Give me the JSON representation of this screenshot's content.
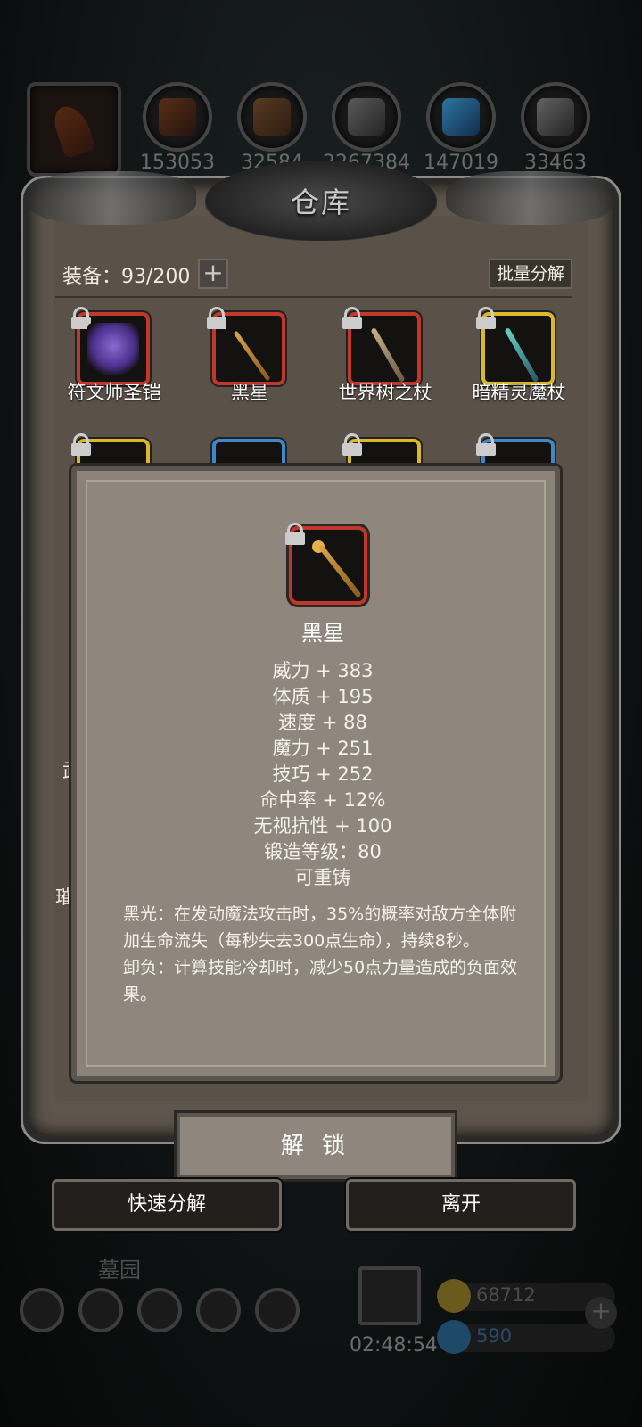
{
  "resources": {
    "counts": [
      "153053",
      "32584",
      "2267384",
      "147019",
      "33463"
    ]
  },
  "warehouse": {
    "title": "仓库",
    "equip_label": "装备：93/200",
    "plus_label": "+",
    "batch_label": "批量分解",
    "items_row1": [
      {
        "name": "符文师圣铠",
        "rarity": "red",
        "icon": "armor-icon"
      },
      {
        "name": "黑星",
        "rarity": "red",
        "icon": "staff-icon"
      },
      {
        "name": "世界树之杖",
        "rarity": "red",
        "icon": "staff-icon"
      },
      {
        "name": "暗精灵魔杖",
        "rarity": "gold",
        "icon": "staff-icon"
      }
    ],
    "side_text": {
      "left_1": "武",
      "left_2": "璀"
    }
  },
  "detail": {
    "name": "黑星",
    "stats": [
      "威力 + 383",
      "体质 + 195",
      "速度 + 88",
      "魔力 + 251",
      "技巧 + 252",
      "命中率 + 12%",
      "无视抗性 + 100",
      "锻造等级：80",
      "可重铸"
    ],
    "desc_1": "黑光：在发动魔法攻击时，35%的概率对敌方全体附加生命流失（每秒失去300点生命），持续8秒。",
    "desc_2": "卸负：计算技能冷却时，减少50点力量造成的负面效果。",
    "unlock_label": "解 锁"
  },
  "actions": {
    "quick_decompose": "快速分解",
    "leave": "离开"
  },
  "bottom": {
    "location": "墓园",
    "timer": "02:48:54",
    "gold": "68712",
    "gems": "590"
  },
  "colors": {
    "rarity_red": "#c0382a",
    "rarity_gold": "#d9b82b",
    "rarity_blue": "#3f88c8"
  }
}
